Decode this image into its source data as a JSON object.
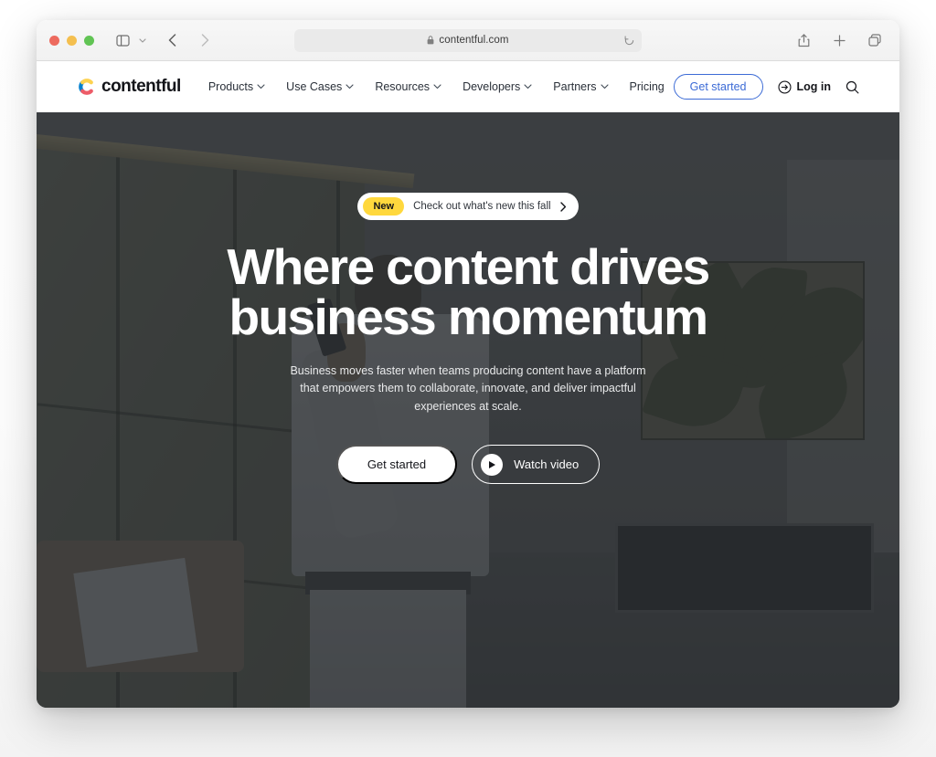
{
  "browser": {
    "traffic_lights": [
      "close",
      "minimize",
      "maximize"
    ],
    "sidebar_icon": "sidebar-icon",
    "sidebar_chevron_icon": "chevron-down-icon",
    "back_icon": "chevron-left-icon",
    "forward_icon": "chevron-right-icon",
    "shield_icon": "privacy-shield-icon",
    "lock_icon": "lock-icon",
    "url": "contentful.com",
    "reload_icon": "reload-icon",
    "share_icon": "share-icon",
    "new_tab_icon": "plus-icon",
    "tabs_icon": "tab-overview-icon"
  },
  "site_nav": {
    "brand": "contentful",
    "brand_mark_icon": "contentful-logo-icon",
    "links": [
      {
        "label": "Products",
        "has_chevron": true
      },
      {
        "label": "Use Cases",
        "has_chevron": true
      },
      {
        "label": "Resources",
        "has_chevron": true
      },
      {
        "label": "Developers",
        "has_chevron": true
      },
      {
        "label": "Partners",
        "has_chevron": true
      },
      {
        "label": "Pricing",
        "has_chevron": false
      }
    ],
    "get_started": "Get started",
    "login": "Log in",
    "login_icon": "login-arrow-icon",
    "search_icon": "search-icon",
    "accent_blue": "#3c6bd6"
  },
  "hero": {
    "announcement": {
      "badge": "New",
      "text": "Check out what's new this fall",
      "chevron_icon": "chevron-right-icon",
      "badge_color": "#ffd83d"
    },
    "title_line_1": "Where content drives",
    "title_line_2": "business momentum",
    "subtitle": "Business moves faster when teams producing content have a platform that empowers them to collaborate, innovate, and deliver impactful experiences at scale.",
    "cta_primary": "Get started",
    "cta_secondary": "Watch video",
    "play_icon": "play-icon",
    "background_alt": "office-interior-person-with-phone"
  }
}
